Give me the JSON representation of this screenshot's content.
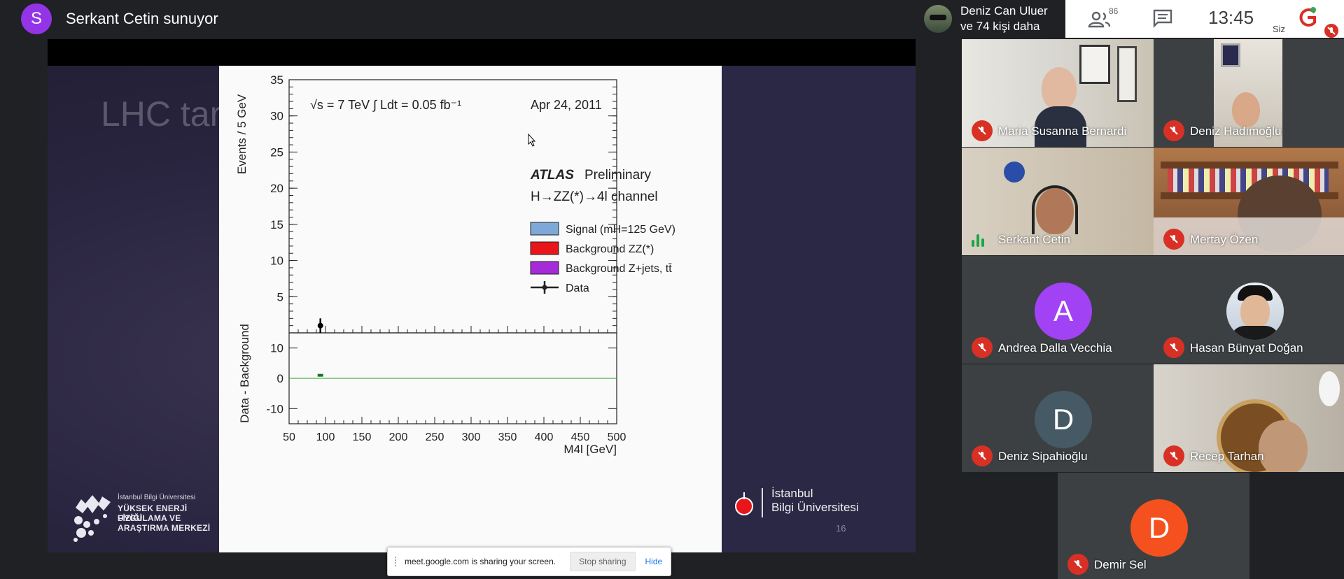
{
  "presenter": {
    "initial": "S",
    "title": "Serkant Cetin sunuyor"
  },
  "header": {
    "people_summary_line1": "Deniz Can Uluer",
    "people_summary_line2": "ve 74 kişi daha",
    "participant_count": "86",
    "time": "13:45",
    "self_label": "Siz"
  },
  "slide": {
    "title": "LHC tarihçesi ve takvimi...",
    "page_number": "16",
    "left_logo": {
      "small": "İstanbul Bilgi Üniversitesi",
      "line1": "YÜKSEK ENERJİ FİZİĞİ",
      "line2": "UYGULAMA VE",
      "line3": "ARAŞTIRMA MERKEZİ"
    },
    "right_logo": {
      "line1": "İstanbul",
      "line2": "Bilgi Üniversitesi"
    }
  },
  "chart_data": {
    "type": "scatter",
    "header_text": "√s = 7 TeV  ∫ Ldt = 0.05 fb⁻¹",
    "date": "Apr 24, 2011",
    "experiment": "ATLAS",
    "experiment_tag": "Preliminary",
    "channel": "H→ZZ(*)→4l channel",
    "legend": [
      {
        "label": "Signal (mH=125 GeV)",
        "color": "#7ea8d8",
        "kind": "box"
      },
      {
        "label": "Background ZZ(*)",
        "color": "#e8161a",
        "kind": "box"
      },
      {
        "label": "Background Z+jets, tt̄",
        "color": "#a52ad8",
        "kind": "box"
      },
      {
        "label": "Data",
        "color": "#000000",
        "kind": "marker"
      }
    ],
    "xlabel": "M4l [GeV]",
    "ylabel_top": "Events / 5 GeV",
    "ylabel_bottom": "Data - Background",
    "xlim": [
      50,
      500
    ],
    "ylim_top": [
      0,
      35
    ],
    "ylim_bottom": [
      -15,
      15
    ],
    "x_ticks": [
      50,
      100,
      150,
      200,
      250,
      300,
      350,
      400,
      450,
      500
    ],
    "y_ticks_top": [
      5,
      10,
      15,
      20,
      25,
      30,
      35
    ],
    "y_ticks_bottom": [
      -10,
      0,
      10
    ],
    "data_points": [
      {
        "x": 93,
        "y": 1,
        "err": 1
      }
    ],
    "residual_points": [
      {
        "x": 93,
        "y": 1
      }
    ]
  },
  "share_bar": {
    "message": "meet.google.com is sharing your screen.",
    "stop": "Stop sharing",
    "hide": "Hide"
  },
  "participants": [
    {
      "name": "Maria Susanna Bernardi",
      "muted": true,
      "type": "video"
    },
    {
      "name": "Deniz Hadımoğlu",
      "muted": true,
      "type": "video"
    },
    {
      "name": "Serkant Cetin",
      "muted": false,
      "type": "video"
    },
    {
      "name": "Mertay Özen",
      "muted": true,
      "type": "video"
    },
    {
      "name": "Andrea Dalla Vecchia",
      "muted": true,
      "type": "letter",
      "initial": "A",
      "color": "#a142f4"
    },
    {
      "name": "Hasan Bünyat Doğan",
      "muted": true,
      "type": "photo"
    },
    {
      "name": "Deniz Sipahioğlu",
      "muted": true,
      "type": "letter",
      "initial": "D",
      "color": "#455a64"
    },
    {
      "name": "Recep Tarhan",
      "muted": true,
      "type": "video"
    },
    {
      "name": "Demir Sel",
      "muted": true,
      "type": "letter",
      "initial": "D",
      "color": "#f4511e"
    }
  ]
}
